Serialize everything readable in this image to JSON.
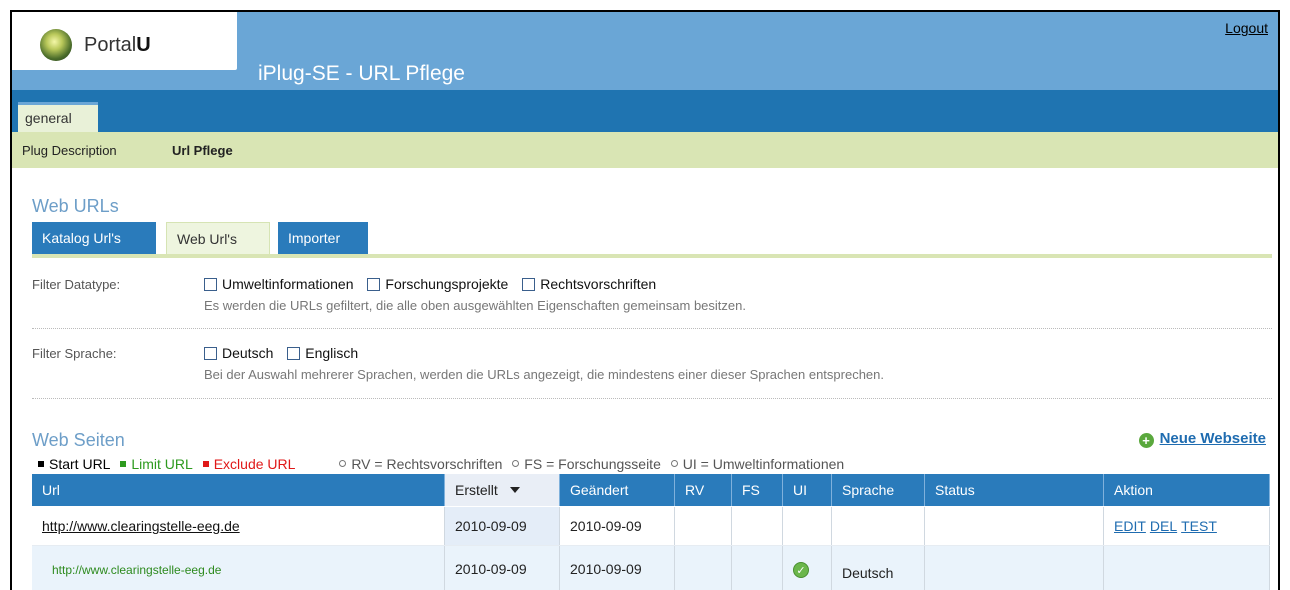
{
  "header": {
    "logo_text": "Portal",
    "logo_bold": "U",
    "title": "iPlug-SE - URL Pflege",
    "logout": "Logout"
  },
  "nav": {
    "tab": "general",
    "subnav": [
      "Plug Description",
      "Url Pflege"
    ]
  },
  "web_urls": {
    "title": "Web URLs",
    "tabs": [
      "Katalog Url's",
      "Web Url's",
      "Importer"
    ]
  },
  "filters": {
    "datatype_label": "Filter Datatype:",
    "datatype_options": [
      "Umweltinformationen",
      "Forschungsprojekte",
      "Rechtsvorschriften"
    ],
    "datatype_hint": "Es werden die URLs gefiltert, die alle oben ausgewählten Eigenschaften gemeinsam besitzen.",
    "language_label": "Filter Sprache:",
    "language_options": [
      "Deutsch",
      "Englisch"
    ],
    "language_hint": "Bei der Auswahl mehrerer Sprachen, werden die URLs angezeigt, die mindestens einer dieser Sprachen entsprechen."
  },
  "web_seiten": {
    "title": "Web Seiten",
    "new_link": "Neue Webseite",
    "legend": {
      "start": "Start URL",
      "limit": "Limit URL",
      "exclude": "Exclude URL",
      "rv": "RV = Rechtsvorschriften",
      "fs": "FS = Forschungsseite",
      "ui": "UI = Umweltinformationen"
    },
    "colors": {
      "start": "#000000",
      "limit": "#2d9a1e",
      "exclude": "#e01818"
    }
  },
  "table": {
    "headers": [
      "Url",
      "Erstellt",
      "Geändert",
      "RV",
      "FS",
      "UI",
      "Sprache",
      "Status",
      "Aktion"
    ],
    "rows": [
      {
        "url": "http://www.clearingstelle-eeg.de",
        "created": "2010-09-09",
        "changed": "2010-09-09",
        "rv": "",
        "fs": "",
        "ui": "",
        "language": "",
        "status": "",
        "actions": [
          "EDIT",
          "DEL",
          "TEST"
        ]
      },
      {
        "url": "http://www.clearingstelle-eeg.de",
        "created": "2010-09-09",
        "changed": "2010-09-09",
        "rv": "",
        "fs": "",
        "ui": "check-icon",
        "language": "Deutsch",
        "status": "",
        "actions": []
      }
    ]
  }
}
